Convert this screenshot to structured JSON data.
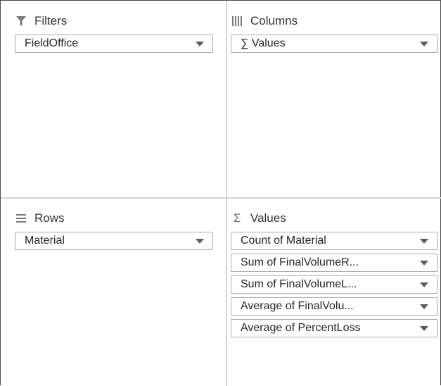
{
  "filters": {
    "title": "Filters",
    "icon": "funnel-icon",
    "fields": [
      {
        "label": "FieldOffice"
      }
    ]
  },
  "columns": {
    "title": "Columns",
    "icon": "columns-icon",
    "fields": [
      {
        "label": "∑ Values"
      }
    ]
  },
  "rows": {
    "title": "Rows",
    "icon": "rows-icon",
    "fields": [
      {
        "label": "Material"
      }
    ]
  },
  "values": {
    "title": "Values",
    "icon": "sigma-icon",
    "fields": [
      {
        "label": "Count of Material"
      },
      {
        "label": "Sum of FinalVolumeR..."
      },
      {
        "label": "Sum of FinalVolumeL..."
      },
      {
        "label": "Average of FinalVolu..."
      },
      {
        "label": "Average of PercentLoss"
      }
    ]
  }
}
